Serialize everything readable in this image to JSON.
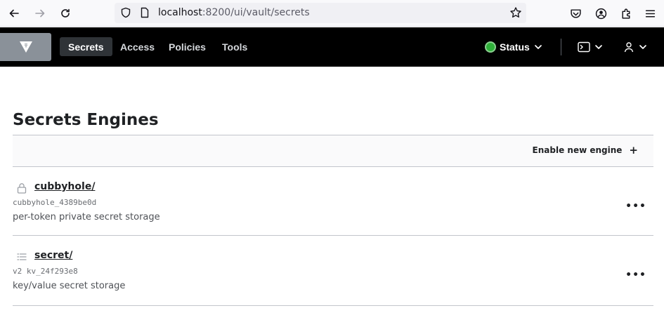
{
  "browser": {
    "url_host": "localhost",
    "url_path": ":8200/ui/vault/secrets"
  },
  "nav": {
    "items": [
      {
        "label": "Secrets",
        "active": true
      },
      {
        "label": "Access",
        "active": false
      },
      {
        "label": "Policies",
        "active": false
      },
      {
        "label": "Tools",
        "active": false
      }
    ],
    "status_label": "Status",
    "status_color": "#2eb039"
  },
  "main": {
    "title": "Secrets Engines",
    "enable_label": "Enable new engine",
    "engines": [
      {
        "name": "cubbyhole/",
        "accessor": "cubbyhole_4389be0d",
        "description": "per-token private secret storage",
        "icon": "lock-icon"
      },
      {
        "name": "secret/",
        "accessor": "v2 kv_24f293e8",
        "description": "key/value secret storage",
        "icon": "list-icon"
      }
    ]
  }
}
